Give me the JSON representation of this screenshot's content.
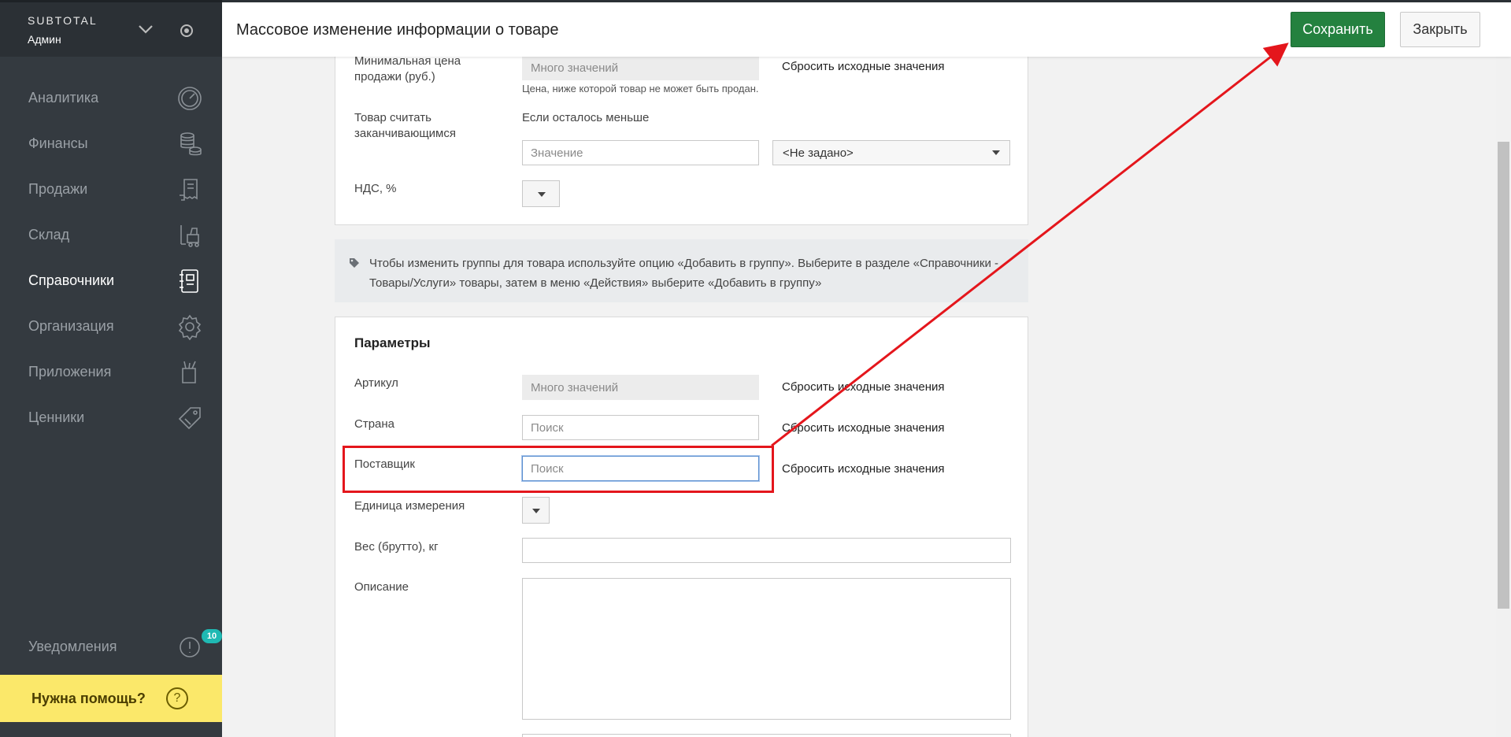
{
  "sidebar": {
    "brand": "SUBTOTAL",
    "user": "Админ",
    "items": [
      {
        "label": "Аналитика",
        "icon": "gauge-icon"
      },
      {
        "label": "Финансы",
        "icon": "coins-icon"
      },
      {
        "label": "Продажи",
        "icon": "receipt-icon"
      },
      {
        "label": "Склад",
        "icon": "forklift-icon"
      },
      {
        "label": "Справочники",
        "icon": "notebook-icon",
        "active": true
      },
      {
        "label": "Организация",
        "icon": "gear-icon"
      },
      {
        "label": "Приложения",
        "icon": "tools-icon"
      },
      {
        "label": "Ценники",
        "icon": "price-tag-icon"
      }
    ],
    "notifications": {
      "label": "Уведомления",
      "count": "10"
    },
    "help": {
      "label": "Нужна помощь?",
      "icon_text": "?"
    }
  },
  "header": {
    "title": "Массовое изменение информации о товаре",
    "save_label": "Сохранить",
    "close_label": "Закрыть"
  },
  "form_top": {
    "min_price_label": "Минимальная цена продажи (руб.)",
    "min_price_placeholder": "Много значений",
    "min_price_hint": "Цена, ниже которой товар не может быть продан.",
    "reset_label": "Сбросить исходные значения",
    "ending_label": "Товар считать заканчивающимся",
    "ending_condition": "Если осталось меньше",
    "ending_value_placeholder": "Значение",
    "ending_unit_selected": "<Не задано>",
    "vat_label": "НДС, %"
  },
  "info": {
    "text": "Чтобы изменить группы для товара используйте опцию «Добавить в группу». Выберите в разделе «Справочники - Товары/Услуги» товары, затем в меню «Действия» выберите «Добавить в группу»"
  },
  "params": {
    "title": "Параметры",
    "article_label": "Артикул",
    "article_placeholder": "Много значений",
    "country_label": "Страна",
    "country_placeholder": "Поиск",
    "supplier_label": "Поставщик",
    "supplier_placeholder": "Поиск",
    "unit_label": "Единица измерения",
    "weight_label": "Вес (брутто), кг",
    "description_label": "Описание",
    "reset_label": "Сбросить исходные значения"
  },
  "colors": {
    "sidebar_bg": "#343a40",
    "save_button": "#24813f",
    "highlight": "#e4161c",
    "help_bg": "#fbe86a",
    "badge": "#1fb9b3"
  }
}
